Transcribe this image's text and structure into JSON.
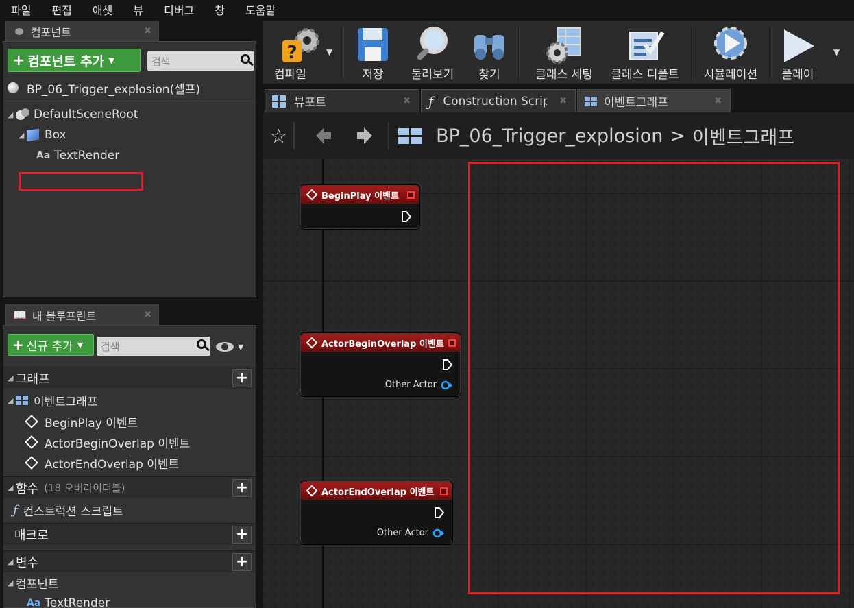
{
  "menu": [
    "파일",
    "편집",
    "애셋",
    "뷰",
    "디버그",
    "창",
    "도움말"
  ],
  "components_panel": {
    "tab_label": "컴포넌트",
    "add_button_label": "컴포넌트 추가",
    "search_placeholder": "검색",
    "self_label": "BP_06_Trigger_explosion(셀프)",
    "tree": [
      {
        "label": "DefaultSceneRoot",
        "icon": "scene-root-icon"
      },
      {
        "label": "Box",
        "icon": "box-icon"
      },
      {
        "label": "TextRender",
        "icon": "text-render-icon"
      }
    ]
  },
  "my_blueprint_panel": {
    "tab_label": "내 블루프린트",
    "add_new_label": "신규 추가",
    "search_placeholder": "검색",
    "graphs_section": "그래프",
    "event_graph_label": "이벤트그래프",
    "events": [
      "BeginPlay 이벤트",
      "ActorBeginOverlap 이벤트",
      "ActorEndOverlap 이벤트"
    ],
    "functions_section": "함수",
    "functions_note": "(18 오버라이더블)",
    "construction_script_label": "컨스트럭션 스크립트",
    "macros_section": "매크로",
    "variables_section": "변수",
    "components_category": "컴포넌트",
    "component_var": "TextRender"
  },
  "toolbar": {
    "buttons": [
      "컴파일",
      "저장",
      "둘러보기",
      "찾기",
      "클래스 세팅",
      "클래스 디폴트",
      "시뮬레이션",
      "플레이"
    ]
  },
  "doc_tabs": [
    "뷰포트",
    "Construction Script",
    "이벤트그래프"
  ],
  "breadcrumb": {
    "blueprint": "BP_06_Trigger_explosion",
    "separator": ">",
    "graph": "이벤트그래프"
  },
  "nodes": [
    {
      "title": "BeginPlay 이벤트",
      "pin": ""
    },
    {
      "title": "ActorBeginOverlap 이벤트",
      "pin": "Other Actor"
    },
    {
      "title": "ActorEndOverlap 이벤트",
      "pin": "Other Actor"
    }
  ],
  "colors": {
    "accent_green": "#3d9b3d",
    "event_node_red": "#a31c1c",
    "highlight_red": "#e01e26",
    "object_pin_blue": "#22a6ff"
  }
}
